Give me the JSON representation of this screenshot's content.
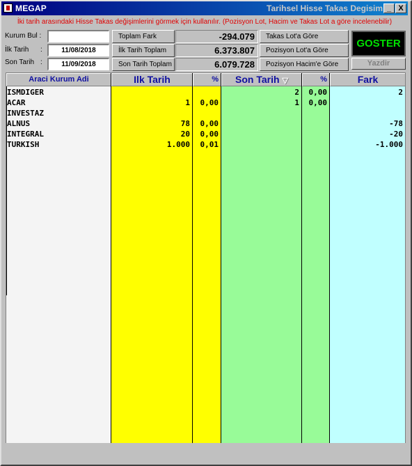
{
  "window": {
    "title": "MEGAP",
    "title_right": "Tarihsel Hisse Takas Degisim",
    "minimize_label": "_",
    "close_label": "X"
  },
  "info_text": "İki tarih arasındaki Hisse Takas değişimlerini görmek için kullanılır. (Pozisyon Lot, Hacim ve Takas Lot a göre incelenebilir)",
  "filters": {
    "kurum_bul_label": "Kurum Bul :",
    "kurum_bul_value": "",
    "ilk_tarih_label": "İlk Tarih",
    "ilk_tarih_value": "11/08/2018",
    "son_tarih_label": "Son Tarih",
    "son_tarih_value": "11/09/2018",
    "colon": ":"
  },
  "summary": {
    "toplam_fark_label": "Toplam Fark",
    "toplam_fark_value": "-294.079",
    "ilk_tarih_toplam_label": "İlk Tarih Toplam",
    "ilk_tarih_toplam_value": "6.373.807",
    "son_tarih_toplam_label": "Son Tarih Toplam",
    "son_tarih_toplam_value": "6.079.728"
  },
  "options": {
    "takas_lot": "Takas Lot'a Göre",
    "pozisyon_lot": "Pozisyon Lot'a Göre",
    "pozisyon_hacim": "Pozisyon Hacim'e Göre"
  },
  "actions": {
    "goster": "GOSTER",
    "yazdir": "Yazdir"
  },
  "table": {
    "headers": {
      "kurum": "Araci Kurum Adi",
      "ilk_tarih": "Ilk Tarih",
      "ilk_pct": "%",
      "son_tarih": "Son Tarih",
      "son_pct": "%",
      "fark": "Fark"
    },
    "sort_icon": "sort-descending-icon",
    "colors": {
      "ilk": "#ffff00",
      "son": "#98fb98",
      "fark": "#c0ffff",
      "kurum": "#f4f4f4",
      "header_text": "#1010a0",
      "info_text": "#e00000",
      "goster_text": "#00e000"
    },
    "rows": [
      {
        "kurum": "ISMDIGER",
        "ilk": "",
        "ilk_pct": "",
        "son": "2",
        "son_pct": "0,00",
        "fark": "2"
      },
      {
        "kurum": "ACAR",
        "ilk": "1",
        "ilk_pct": "0,00",
        "son": "1",
        "son_pct": "0,00",
        "fark": ""
      },
      {
        "kurum": "INVESTAZ",
        "ilk": "",
        "ilk_pct": "",
        "son": "",
        "son_pct": "",
        "fark": ""
      },
      {
        "kurum": "ALNUS",
        "ilk": "78",
        "ilk_pct": "0,00",
        "son": "",
        "son_pct": "",
        "fark": "-78"
      },
      {
        "kurum": "INTEGRAL",
        "ilk": "20",
        "ilk_pct": "0,00",
        "son": "",
        "son_pct": "",
        "fark": "-20"
      },
      {
        "kurum": "TURKISH",
        "ilk": "1.000",
        "ilk_pct": "0,01",
        "son": "",
        "son_pct": "",
        "fark": "-1.000"
      }
    ]
  }
}
